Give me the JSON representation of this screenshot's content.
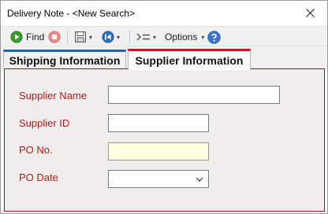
{
  "window": {
    "title": "Delivery Note - <New Search>"
  },
  "toolbar": {
    "find_label": "Find",
    "options_label": "Options",
    "colors": {
      "find_icon": "#3a9b2a",
      "stop_icon": "#e05050",
      "nav_icon": "#2f6fb6",
      "help_icon": "#3d74c6"
    }
  },
  "tabs": [
    {
      "label": "Shipping Information",
      "accent": "#2360b5",
      "active": false
    },
    {
      "label": "Supplier Information",
      "accent": "#c4161c",
      "active": true
    }
  ],
  "form": {
    "fields": [
      {
        "label": "Supplier Name",
        "value": ""
      },
      {
        "label": "Supplier ID",
        "value": ""
      },
      {
        "label": "PO No.",
        "value": ""
      },
      {
        "label": "PO Date",
        "value": ""
      }
    ],
    "label_color": "#b11b1b"
  }
}
